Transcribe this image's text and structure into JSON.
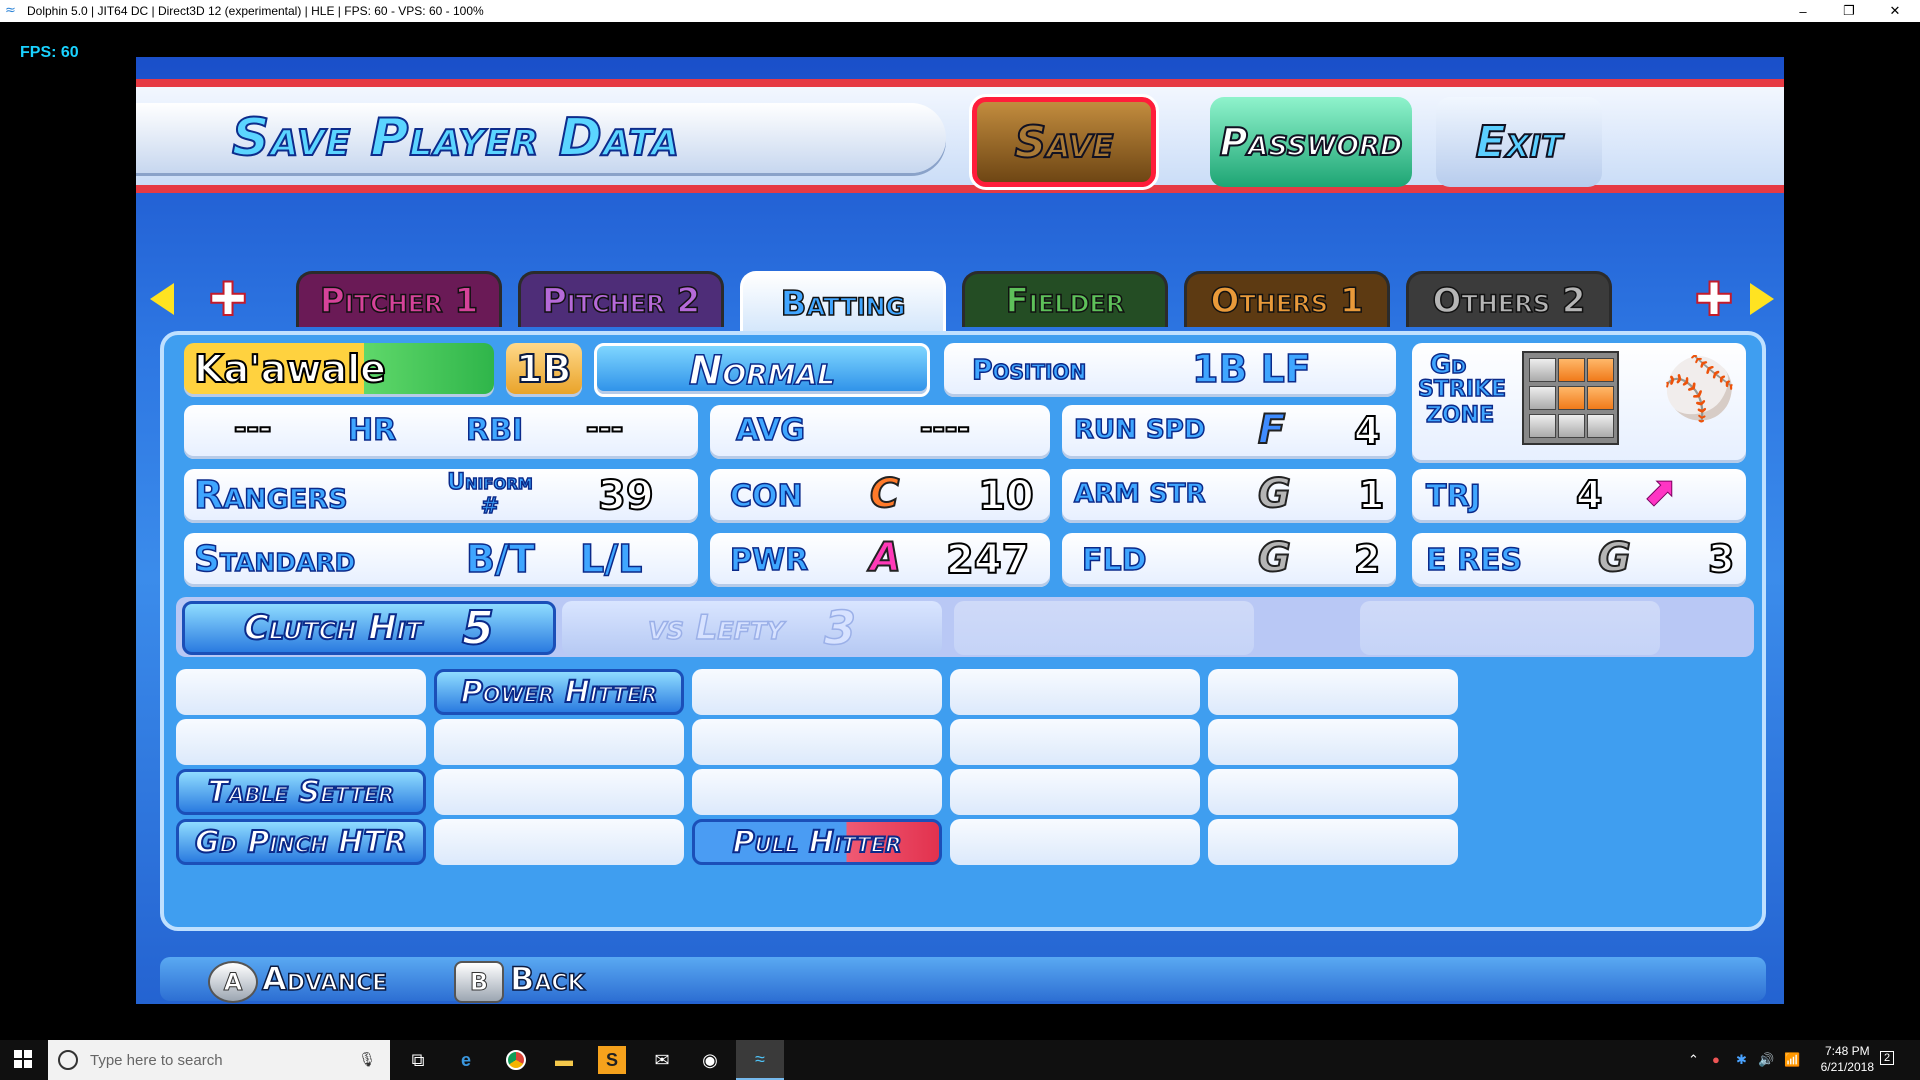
{
  "window": {
    "title": "Dolphin 5.0 | JIT64 DC | Direct3D 12 (experimental) | HLE | FPS: 60 - VPS: 60 - 100%",
    "minimize": "–",
    "restore": "❐",
    "close": "✕"
  },
  "overlay": {
    "fps": "FPS: 60"
  },
  "header": {
    "title": "Save Player Data",
    "save": "Save",
    "password": "Password",
    "exit": "Exit"
  },
  "tabs": [
    {
      "label": "Pitcher 1",
      "color": "#d6439a",
      "bg": "#6a1a56"
    },
    {
      "label": "Pitcher 2",
      "color": "#b66ad9",
      "bg": "#4e2d78"
    },
    {
      "label": "Batting",
      "color": "#41a6ff",
      "bg": "#ffffff"
    },
    {
      "label": "Fielder",
      "color": "#5ec15a",
      "bg": "#244d24"
    },
    {
      "label": "Others 1",
      "color": "#e99a3a",
      "bg": "#5d3a12"
    },
    {
      "label": "Others 2",
      "color": "#b5b5b5",
      "bg": "#3b3b3b"
    }
  ],
  "player": {
    "name": "Ka'awale",
    "position_badge": "1B",
    "form": "Normal",
    "position_label": "Position",
    "positions": "1B LF",
    "hr_value": "---",
    "hr_label": "HR",
    "rbi_label": "RBI",
    "rbi_value": "---",
    "avg_label": "AVG",
    "avg_value": "----",
    "team": "Rangers",
    "uniform_label": "Uniform #",
    "uniform_number": "39",
    "style": "Standard",
    "bt_label": "B/T",
    "bt_value": "L/L"
  },
  "stats": {
    "con": {
      "label": "CON",
      "grade": "C",
      "value": "10",
      "grade_color": "#ff7a2a"
    },
    "pwr": {
      "label": "PWR",
      "grade": "A",
      "value": "247",
      "grade_color": "#ff3ab8"
    },
    "run_spd": {
      "label": "RUN SPD",
      "grade": "F",
      "value": "4",
      "grade_color": "#3f8cff"
    },
    "arm_str": {
      "label": "ARM STR",
      "grade": "G",
      "value": "1",
      "grade_color": "#b5b5b5"
    },
    "fld": {
      "label": "FLD",
      "grade": "G",
      "value": "2",
      "grade_color": "#b5b5b5"
    },
    "trj": {
      "label": "TRJ",
      "value": "4"
    },
    "e_res": {
      "label": "E RES",
      "grade": "G",
      "value": "3",
      "grade_color": "#b5b5b5"
    }
  },
  "strike_zone": {
    "label_1": "Gd",
    "label_2": "STRIKE",
    "label_3": "ZONE",
    "cells": [
      "gray",
      "orange",
      "orange",
      "gray",
      "orange",
      "orange",
      "gray",
      "gray",
      "gray"
    ]
  },
  "skills": {
    "row1": [
      {
        "label": "Clutch Hit",
        "level": "5",
        "state": "on"
      },
      {
        "label": "vs Lefty",
        "level": "3",
        "state": "faded"
      }
    ],
    "row2": [
      "",
      "Power Hitter",
      "",
      "",
      ""
    ],
    "row3": [
      "",
      "",
      "",
      "",
      ""
    ],
    "row4": [
      "Table Setter",
      "",
      "",
      "",
      ""
    ],
    "row5": [
      "Gd Pinch HTR",
      "",
      "Pull Hitter",
      "",
      ""
    ]
  },
  "footer": {
    "a_button": "A",
    "a_label": "Advance",
    "b_button": "B",
    "b_label": "Back"
  },
  "taskbar": {
    "search_placeholder": "Type here to search",
    "time": "7:48 PM",
    "date": "6/21/2018",
    "notifications": "2"
  }
}
